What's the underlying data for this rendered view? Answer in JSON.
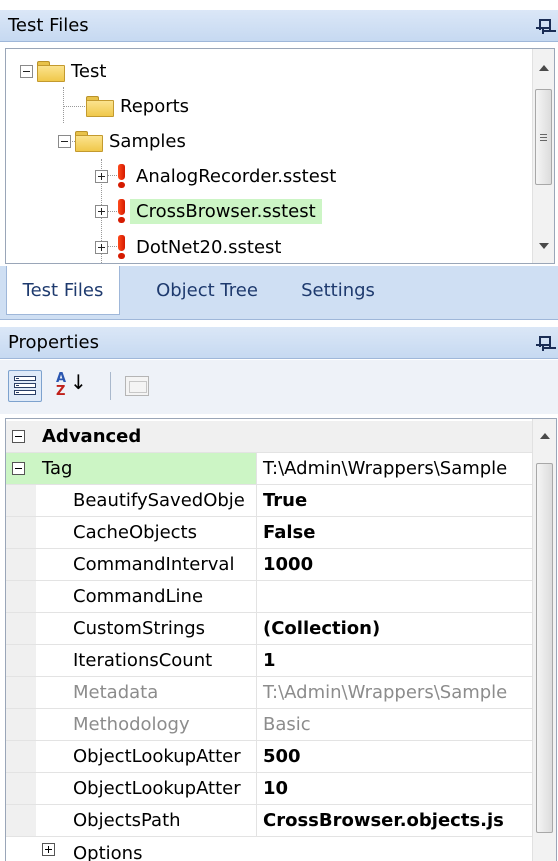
{
  "test_files_panel": {
    "title": "Test Files",
    "pin_icon": "pin-icon",
    "tree": [
      {
        "label": "Test",
        "type": "folder",
        "state": "expanded"
      },
      {
        "label": "Reports",
        "type": "folder",
        "state": "none"
      },
      {
        "label": "Samples",
        "type": "folder",
        "state": "expanded"
      },
      {
        "label": "AnalogRecorder.sstest",
        "type": "test",
        "state": "collapsed"
      },
      {
        "label": "CrossBrowser.sstest",
        "type": "test",
        "state": "collapsed",
        "selected": true
      },
      {
        "label": "DotNet20.sstest",
        "type": "test",
        "state": "collapsed"
      }
    ]
  },
  "tabs": [
    {
      "label": "Test Files",
      "active": true
    },
    {
      "label": "Object Tree",
      "active": false
    },
    {
      "label": "Settings",
      "active": false
    }
  ],
  "properties_panel": {
    "title": "Properties",
    "toolbar": {
      "categorized_icon": "categorized-icon",
      "alphabetical_icon": "alphabetical-sort-icon",
      "property_pages_icon": "property-pages-icon"
    },
    "category": "Advanced",
    "tag": {
      "name": "Tag",
      "value": "T:\\Admin\\Wrappers\\Sample"
    },
    "rows": [
      {
        "name": "BeautifySavedObje",
        "value": "True",
        "bold": true,
        "grey": false
      },
      {
        "name": "CacheObjects",
        "value": "False",
        "bold": true,
        "grey": false
      },
      {
        "name": "CommandInterval",
        "value": "1000",
        "bold": true,
        "grey": false
      },
      {
        "name": "CommandLine",
        "value": "",
        "bold": false,
        "grey": false
      },
      {
        "name": "CustomStrings",
        "value": "(Collection)",
        "bold": true,
        "grey": false
      },
      {
        "name": "IterationsCount",
        "value": "1",
        "bold": true,
        "grey": false
      },
      {
        "name": "Metadata",
        "value": "T:\\Admin\\Wrappers\\Sample",
        "bold": false,
        "grey": true
      },
      {
        "name": "Methodology",
        "value": "Basic",
        "bold": false,
        "grey": true
      },
      {
        "name": "ObjectLookupAtter",
        "value": "500",
        "bold": true,
        "grey": false
      },
      {
        "name": "ObjectLookupAtter",
        "value": "10",
        "bold": true,
        "grey": false
      },
      {
        "name": "ObjectsPath",
        "value": "CrossBrowser.objects.js",
        "bold": true,
        "grey": false
      }
    ],
    "options": {
      "name": "Options"
    }
  },
  "colors": {
    "selection_green": "#ccf5c5",
    "titlebar": "#c6d9f1",
    "tab_text": "#1e3a6e"
  }
}
